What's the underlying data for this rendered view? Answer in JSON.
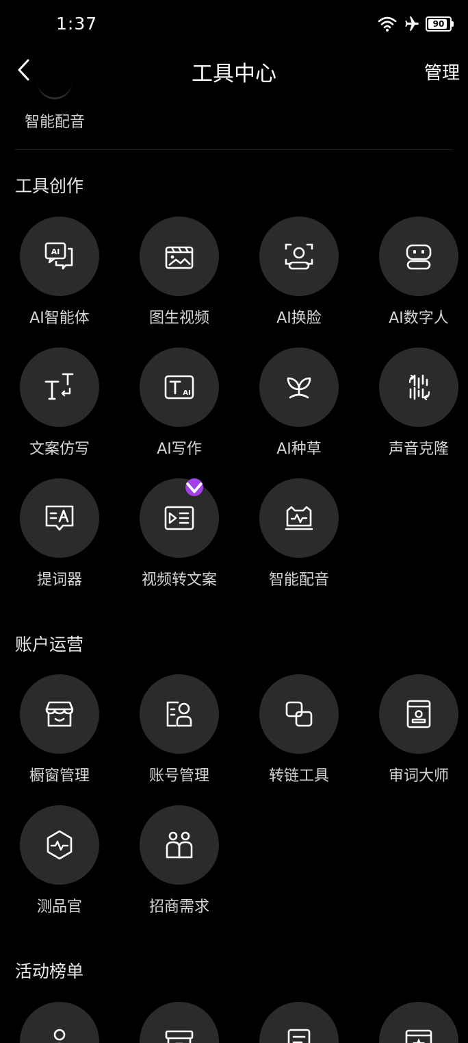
{
  "status": {
    "time": "1:37",
    "battery": "90",
    "battery_percent": 90
  },
  "header": {
    "title": "工具中心",
    "manage": "管理"
  },
  "previous_item": {
    "label": "智能配音"
  },
  "sections": {
    "tools": {
      "title": "工具创作",
      "items": [
        {
          "label": "AI智能体",
          "icon": "ai-chat-icon"
        },
        {
          "label": "图生视频",
          "icon": "image-video-icon"
        },
        {
          "label": "AI换脸",
          "icon": "face-scan-icon"
        },
        {
          "label": "AI数字人",
          "icon": "robot-icon"
        },
        {
          "label": "文案仿写",
          "icon": "text-rewrite-icon"
        },
        {
          "label": "AI写作",
          "icon": "ai-write-icon"
        },
        {
          "label": "AI种草",
          "icon": "sprout-icon"
        },
        {
          "label": "声音克隆",
          "icon": "voice-clone-icon"
        },
        {
          "label": "提词器",
          "icon": "teleprompter-icon"
        },
        {
          "label": "视频转文案",
          "icon": "video-to-text-icon",
          "badge": "vip-diamond-icon"
        },
        {
          "label": "智能配音",
          "icon": "dubbing-icon"
        }
      ]
    },
    "account": {
      "title": "账户运营",
      "items": [
        {
          "label": "橱窗管理",
          "icon": "storefront-icon"
        },
        {
          "label": "账号管理",
          "icon": "account-icon"
        },
        {
          "label": "转链工具",
          "icon": "link-convert-icon"
        },
        {
          "label": "审词大师",
          "icon": "word-check-icon"
        },
        {
          "label": "测品官",
          "icon": "product-test-icon"
        },
        {
          "label": "招商需求",
          "icon": "merchants-icon"
        }
      ]
    },
    "activity": {
      "title": "活动榜单",
      "items": [
        {
          "icon": "person-icon"
        },
        {
          "icon": "box-icon"
        },
        {
          "icon": "document-icon"
        },
        {
          "icon": "star-board-icon"
        }
      ]
    }
  }
}
